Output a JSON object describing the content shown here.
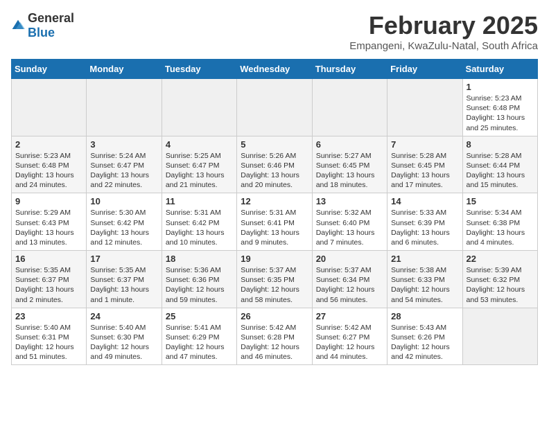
{
  "logo": {
    "general": "General",
    "blue": "Blue"
  },
  "title": "February 2025",
  "subtitle": "Empangeni, KwaZulu-Natal, South Africa",
  "weekdays": [
    "Sunday",
    "Monday",
    "Tuesday",
    "Wednesday",
    "Thursday",
    "Friday",
    "Saturday"
  ],
  "weeks": [
    [
      {
        "day": "",
        "info": ""
      },
      {
        "day": "",
        "info": ""
      },
      {
        "day": "",
        "info": ""
      },
      {
        "day": "",
        "info": ""
      },
      {
        "day": "",
        "info": ""
      },
      {
        "day": "",
        "info": ""
      },
      {
        "day": "1",
        "info": "Sunrise: 5:23 AM\nSunset: 6:48 PM\nDaylight: 13 hours\nand 25 minutes."
      }
    ],
    [
      {
        "day": "2",
        "info": "Sunrise: 5:23 AM\nSunset: 6:48 PM\nDaylight: 13 hours\nand 24 minutes."
      },
      {
        "day": "3",
        "info": "Sunrise: 5:24 AM\nSunset: 6:47 PM\nDaylight: 13 hours\nand 22 minutes."
      },
      {
        "day": "4",
        "info": "Sunrise: 5:25 AM\nSunset: 6:47 PM\nDaylight: 13 hours\nand 21 minutes."
      },
      {
        "day": "5",
        "info": "Sunrise: 5:26 AM\nSunset: 6:46 PM\nDaylight: 13 hours\nand 20 minutes."
      },
      {
        "day": "6",
        "info": "Sunrise: 5:27 AM\nSunset: 6:45 PM\nDaylight: 13 hours\nand 18 minutes."
      },
      {
        "day": "7",
        "info": "Sunrise: 5:28 AM\nSunset: 6:45 PM\nDaylight: 13 hours\nand 17 minutes."
      },
      {
        "day": "8",
        "info": "Sunrise: 5:28 AM\nSunset: 6:44 PM\nDaylight: 13 hours\nand 15 minutes."
      }
    ],
    [
      {
        "day": "9",
        "info": "Sunrise: 5:29 AM\nSunset: 6:43 PM\nDaylight: 13 hours\nand 13 minutes."
      },
      {
        "day": "10",
        "info": "Sunrise: 5:30 AM\nSunset: 6:42 PM\nDaylight: 13 hours\nand 12 minutes."
      },
      {
        "day": "11",
        "info": "Sunrise: 5:31 AM\nSunset: 6:42 PM\nDaylight: 13 hours\nand 10 minutes."
      },
      {
        "day": "12",
        "info": "Sunrise: 5:31 AM\nSunset: 6:41 PM\nDaylight: 13 hours\nand 9 minutes."
      },
      {
        "day": "13",
        "info": "Sunrise: 5:32 AM\nSunset: 6:40 PM\nDaylight: 13 hours\nand 7 minutes."
      },
      {
        "day": "14",
        "info": "Sunrise: 5:33 AM\nSunset: 6:39 PM\nDaylight: 13 hours\nand 6 minutes."
      },
      {
        "day": "15",
        "info": "Sunrise: 5:34 AM\nSunset: 6:38 PM\nDaylight: 13 hours\nand 4 minutes."
      }
    ],
    [
      {
        "day": "16",
        "info": "Sunrise: 5:35 AM\nSunset: 6:37 PM\nDaylight: 13 hours\nand 2 minutes."
      },
      {
        "day": "17",
        "info": "Sunrise: 5:35 AM\nSunset: 6:37 PM\nDaylight: 13 hours\nand 1 minute."
      },
      {
        "day": "18",
        "info": "Sunrise: 5:36 AM\nSunset: 6:36 PM\nDaylight: 12 hours\nand 59 minutes."
      },
      {
        "day": "19",
        "info": "Sunrise: 5:37 AM\nSunset: 6:35 PM\nDaylight: 12 hours\nand 58 minutes."
      },
      {
        "day": "20",
        "info": "Sunrise: 5:37 AM\nSunset: 6:34 PM\nDaylight: 12 hours\nand 56 minutes."
      },
      {
        "day": "21",
        "info": "Sunrise: 5:38 AM\nSunset: 6:33 PM\nDaylight: 12 hours\nand 54 minutes."
      },
      {
        "day": "22",
        "info": "Sunrise: 5:39 AM\nSunset: 6:32 PM\nDaylight: 12 hours\nand 53 minutes."
      }
    ],
    [
      {
        "day": "23",
        "info": "Sunrise: 5:40 AM\nSunset: 6:31 PM\nDaylight: 12 hours\nand 51 minutes."
      },
      {
        "day": "24",
        "info": "Sunrise: 5:40 AM\nSunset: 6:30 PM\nDaylight: 12 hours\nand 49 minutes."
      },
      {
        "day": "25",
        "info": "Sunrise: 5:41 AM\nSunset: 6:29 PM\nDaylight: 12 hours\nand 47 minutes."
      },
      {
        "day": "26",
        "info": "Sunrise: 5:42 AM\nSunset: 6:28 PM\nDaylight: 12 hours\nand 46 minutes."
      },
      {
        "day": "27",
        "info": "Sunrise: 5:42 AM\nSunset: 6:27 PM\nDaylight: 12 hours\nand 44 minutes."
      },
      {
        "day": "28",
        "info": "Sunrise: 5:43 AM\nSunset: 6:26 PM\nDaylight: 12 hours\nand 42 minutes."
      },
      {
        "day": "",
        "info": ""
      }
    ]
  ]
}
